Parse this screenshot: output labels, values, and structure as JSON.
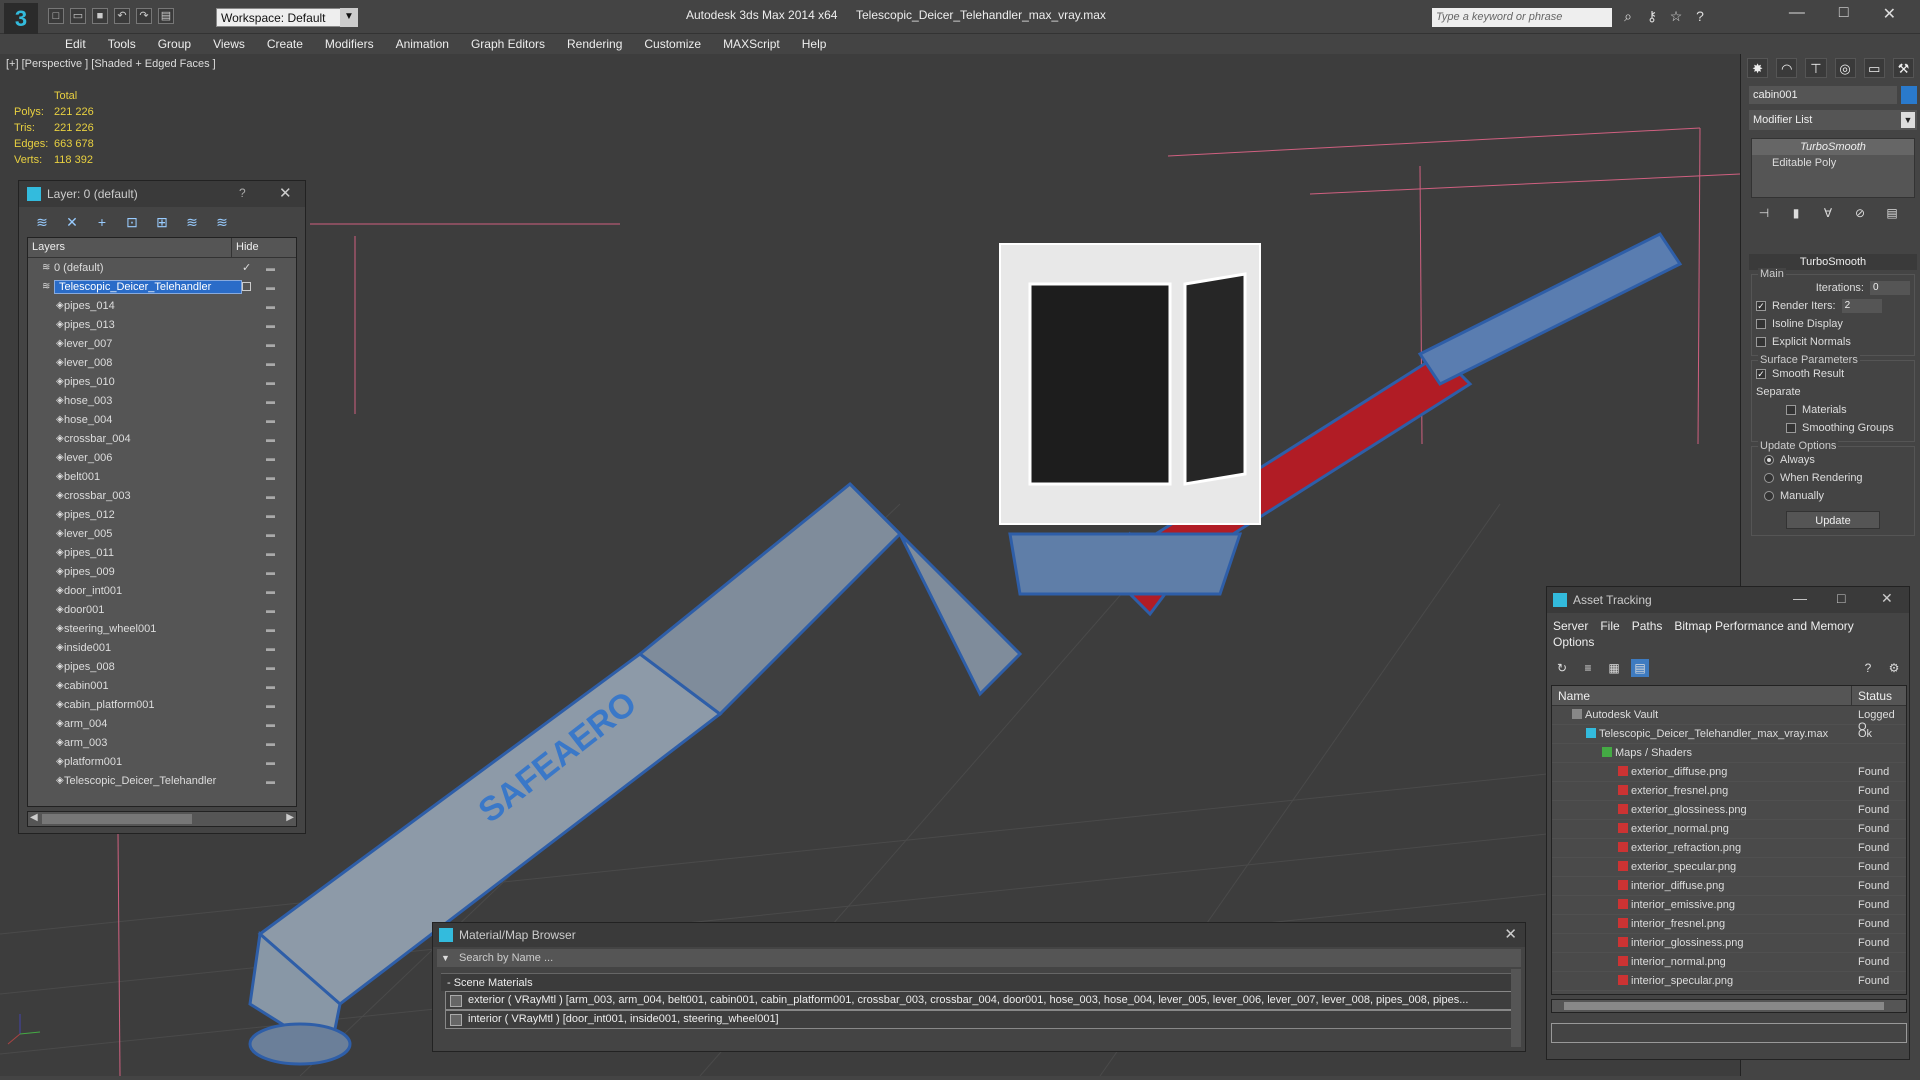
{
  "titlebar": {
    "workspace": "Workspace: Default",
    "app_title": "Autodesk 3ds Max  2014 x64",
    "file_title": "Telescopic_Deicer_Telehandler_max_vray.max",
    "search_placeholder": "Type a keyword or phrase"
  },
  "menu": [
    "Edit",
    "Tools",
    "Group",
    "Views",
    "Create",
    "Modifiers",
    "Animation",
    "Graph Editors",
    "Rendering",
    "Customize",
    "MAXScript",
    "Help"
  ],
  "viewport": {
    "label": "[+] [Perspective ] [Shaded + Edged Faces ]",
    "stats_header": "Total",
    "stats": [
      {
        "k": "Polys:",
        "v": "221 226"
      },
      {
        "k": "Tris:",
        "v": "221 226"
      },
      {
        "k": "Edges:",
        "v": "663 678"
      },
      {
        "k": "Verts:",
        "v": "118 392"
      }
    ],
    "logo_text": "SAFEAERO"
  },
  "layer_window": {
    "title": "Layer: 0 (default)",
    "help": "?",
    "col_layers": "Layers",
    "col_hide": "Hide",
    "layers": [
      {
        "name": "0 (default)",
        "level": 0,
        "check": "✓"
      },
      {
        "name": "Telescopic_Deicer_Telehandler",
        "level": 0,
        "selected": true
      },
      {
        "name": "pipes_014",
        "level": 1
      },
      {
        "name": "pipes_013",
        "level": 1
      },
      {
        "name": "lever_007",
        "level": 1
      },
      {
        "name": "lever_008",
        "level": 1
      },
      {
        "name": "pipes_010",
        "level": 1
      },
      {
        "name": "hose_003",
        "level": 1
      },
      {
        "name": "hose_004",
        "level": 1
      },
      {
        "name": "crossbar_004",
        "level": 1
      },
      {
        "name": "lever_006",
        "level": 1
      },
      {
        "name": "belt001",
        "level": 1
      },
      {
        "name": "crossbar_003",
        "level": 1
      },
      {
        "name": "pipes_012",
        "level": 1
      },
      {
        "name": "lever_005",
        "level": 1
      },
      {
        "name": "pipes_011",
        "level": 1
      },
      {
        "name": "pipes_009",
        "level": 1
      },
      {
        "name": "door_int001",
        "level": 1
      },
      {
        "name": "door001",
        "level": 1
      },
      {
        "name": "steering_wheel001",
        "level": 1
      },
      {
        "name": "inside001",
        "level": 1
      },
      {
        "name": "pipes_008",
        "level": 1
      },
      {
        "name": "cabin001",
        "level": 1
      },
      {
        "name": "cabin_platform001",
        "level": 1
      },
      {
        "name": "arm_004",
        "level": 1
      },
      {
        "name": "arm_003",
        "level": 1
      },
      {
        "name": "platform001",
        "level": 1
      },
      {
        "name": "Telescopic_Deicer_Telehandler",
        "level": 1
      }
    ]
  },
  "command_panel": {
    "object_name": "cabin001",
    "object_color": "#2a7acc",
    "modifier_list": "Modifier List",
    "stack": [
      "TurboSmooth",
      "Editable Poly"
    ],
    "rollout_title": "TurboSmooth",
    "main_label": "Main",
    "iterations_label": "Iterations:",
    "iterations_value": "0",
    "render_iters_label": "Render Iters:",
    "render_iters_value": "2",
    "isoline": "Isoline Display",
    "explicit": "Explicit Normals",
    "surface_label": "Surface Parameters",
    "smooth_result": "Smooth Result",
    "separate": "Separate",
    "materials": "Materials",
    "smoothing_groups": "Smoothing Groups",
    "update_label": "Update Options",
    "always": "Always",
    "when_rendering": "When Rendering",
    "manually": "Manually",
    "update_button": "Update"
  },
  "asset_tracking": {
    "title": "Asset Tracking",
    "menu": [
      "Server",
      "File",
      "Paths",
      "Bitmap Performance and Memory",
      "Options"
    ],
    "col_name": "Name",
    "col_status": "Status",
    "rows": [
      {
        "name": "Autodesk Vault",
        "status": "Logged O",
        "indent": 20,
        "type": "vault"
      },
      {
        "name": "Telescopic_Deicer_Telehandler_max_vray.max",
        "status": "Ok",
        "indent": 34,
        "type": "file"
      },
      {
        "name": "Maps / Shaders",
        "status": "",
        "indent": 50,
        "type": "folder"
      },
      {
        "name": "exterior_diffuse.png",
        "status": "Found",
        "indent": 66,
        "type": "png"
      },
      {
        "name": "exterior_fresnel.png",
        "status": "Found",
        "indent": 66,
        "type": "png"
      },
      {
        "name": "exterior_glossiness.png",
        "status": "Found",
        "indent": 66,
        "type": "png"
      },
      {
        "name": "exterior_normal.png",
        "status": "Found",
        "indent": 66,
        "type": "png"
      },
      {
        "name": "exterior_refraction.png",
        "status": "Found",
        "indent": 66,
        "type": "png"
      },
      {
        "name": "exterior_specular.png",
        "status": "Found",
        "indent": 66,
        "type": "png"
      },
      {
        "name": "interior_diffuse.png",
        "status": "Found",
        "indent": 66,
        "type": "png"
      },
      {
        "name": "interior_emissive.png",
        "status": "Found",
        "indent": 66,
        "type": "png"
      },
      {
        "name": "interior_fresnel.png",
        "status": "Found",
        "indent": 66,
        "type": "png"
      },
      {
        "name": "interior_glossiness.png",
        "status": "Found",
        "indent": 66,
        "type": "png"
      },
      {
        "name": "interior_normal.png",
        "status": "Found",
        "indent": 66,
        "type": "png"
      },
      {
        "name": "interior_specular.png",
        "status": "Found",
        "indent": 66,
        "type": "png"
      }
    ]
  },
  "material_browser": {
    "title": "Material/Map Browser",
    "search_placeholder": "Search by Name ...",
    "section": "- Scene Materials",
    "materials": [
      "exterior  ( VRayMtl ) [arm_003, arm_004, belt001, cabin001, cabin_platform001, crossbar_003, crossbar_004, door001, hose_003, hose_004, lever_005, lever_006, lever_007, lever_008, pipes_008, pipes...",
      "interior  ( VRayMtl ) [door_int001, inside001, steering_wheel001]"
    ]
  }
}
